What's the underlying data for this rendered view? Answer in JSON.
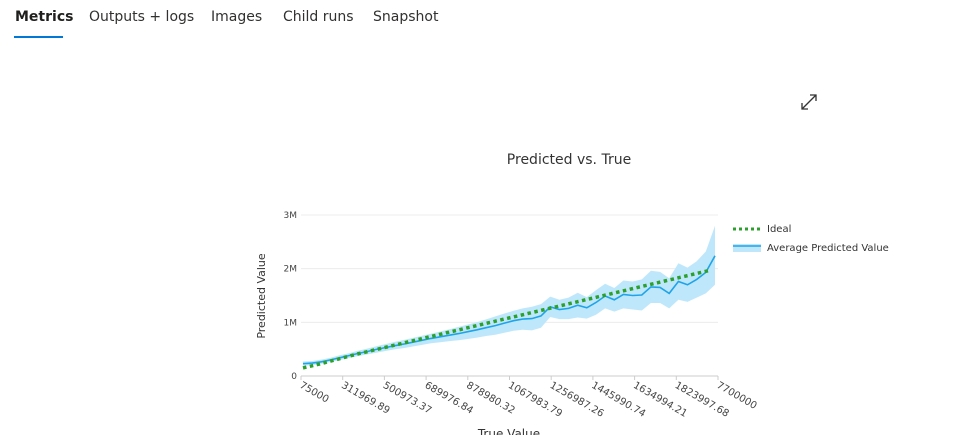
{
  "tabs": [
    {
      "label": "Metrics",
      "active": true
    },
    {
      "label": "Outputs + logs",
      "active": false
    },
    {
      "label": "Images",
      "active": false
    },
    {
      "label": "Child runs",
      "active": false
    },
    {
      "label": "Snapshot",
      "active": false
    }
  ],
  "chart_data": {
    "type": "line",
    "title": "Predicted vs. True",
    "xlabel": "True Value",
    "ylabel": "Predicted Value",
    "ylim": [
      0,
      3000000
    ],
    "yticks": [
      {
        "value": 0,
        "label": "0"
      },
      {
        "value": 1000000,
        "label": "1M"
      },
      {
        "value": 2000000,
        "label": "2M"
      },
      {
        "value": 3000000,
        "label": "3M"
      }
    ],
    "xtick_labels": [
      "75000",
      "311969.89",
      "500973.37",
      "689976.84",
      "878980.32",
      "1067983.79",
      "1256987.26",
      "1445990.74",
      "1634994.21",
      "1823997.68",
      "7700000"
    ],
    "grid": true,
    "legend_position": "right",
    "series": [
      {
        "name": "Ideal",
        "style": "dotted",
        "color": "#2ca02c",
        "values": [
          150000,
          190000,
          230000,
          275000,
          320000,
          365000,
          410000,
          450000,
          490000,
          530000,
          570000,
          610000,
          650000,
          690000,
          730000,
          770000,
          810000,
          850000,
          890000,
          930000,
          970000,
          1010000,
          1050000,
          1090000,
          1130000,
          1170000,
          1210000,
          1250000,
          1290000,
          1330000,
          1370000,
          1410000,
          1450000,
          1490000,
          1530000,
          1570000,
          1610000,
          1650000,
          1690000,
          1730000,
          1770000,
          1810000,
          1850000,
          1890000,
          1930000,
          1970000
        ]
      },
      {
        "name": "Average Predicted Value",
        "style": "solid",
        "color": "#20a4e8",
        "values": [
          230000,
          240000,
          265000,
          300000,
          340000,
          380000,
          420000,
          455000,
          495000,
          530000,
          565000,
          595000,
          630000,
          665000,
          700000,
          730000,
          760000,
          790000,
          825000,
          860000,
          900000,
          940000,
          985000,
          1030000,
          1060000,
          1070000,
          1120000,
          1290000,
          1240000,
          1260000,
          1320000,
          1270000,
          1370000,
          1490000,
          1420000,
          1520000,
          1500000,
          1510000,
          1660000,
          1650000,
          1540000,
          1760000,
          1700000,
          1800000,
          1930000,
          2240000
        ],
        "band_upper": [
          270000,
          280000,
          305000,
          340000,
          385000,
          425000,
          470000,
          510000,
          555000,
          595000,
          635000,
          670000,
          710000,
          750000,
          790000,
          830000,
          870000,
          915000,
          960000,
          1005000,
          1055000,
          1110000,
          1165000,
          1215000,
          1260000,
          1290000,
          1340000,
          1480000,
          1420000,
          1460000,
          1550000,
          1470000,
          1600000,
          1720000,
          1640000,
          1780000,
          1760000,
          1800000,
          1960000,
          1940000,
          1820000,
          2100000,
          2020000,
          2140000,
          2320000,
          2800000
        ],
        "band_lower": [
          190000,
          200000,
          225000,
          260000,
          295000,
          335000,
          370000,
          400000,
          435000,
          465000,
          495000,
          520000,
          550000,
          580000,
          610000,
          630000,
          650000,
          665000,
          690000,
          715000,
          745000,
          770000,
          805000,
          845000,
          860000,
          850000,
          900000,
          1100000,
          1060000,
          1060000,
          1090000,
          1070000,
          1140000,
          1260000,
          1200000,
          1260000,
          1240000,
          1220000,
          1360000,
          1360000,
          1260000,
          1420000,
          1380000,
          1460000,
          1540000,
          1700000
        ]
      }
    ]
  }
}
